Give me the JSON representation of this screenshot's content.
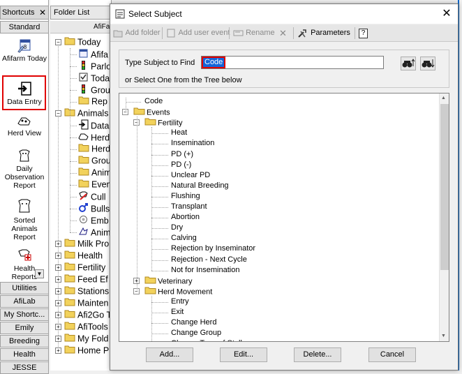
{
  "shortcuts": {
    "header": "Shortcuts",
    "close": "✕",
    "group_top": "Standard",
    "items": [
      {
        "label": "Afifarm Today",
        "icon": "calendar-icon"
      },
      {
        "label": "Data Entry",
        "icon": "data-entry-icon"
      },
      {
        "label": "Herd View",
        "icon": "herd-view-icon"
      },
      {
        "label": "Daily Observation Report",
        "icon": "cow-report-icon"
      },
      {
        "label": "Sorted Animals Report",
        "icon": "cow-sorted-icon"
      },
      {
        "label": "Health Reports",
        "icon": "health-icon"
      }
    ],
    "groups": [
      "Utilities",
      "AfiLab",
      "My Shortc...",
      "Emily",
      "Breeding",
      "Health",
      "JESSE"
    ]
  },
  "folder_list": {
    "header": "Folder List",
    "sub_header": "AfiFa",
    "rows": [
      {
        "label": "Today",
        "icon": "folder-icon",
        "level": 0,
        "expander": "−"
      },
      {
        "label": "Afifa",
        "icon": "calendar-icon",
        "level": 1
      },
      {
        "label": "Parlo",
        "icon": "traffic-light-icon",
        "level": 1
      },
      {
        "label": "Toda",
        "icon": "checkbox-icon",
        "level": 1
      },
      {
        "label": "Grou",
        "icon": "traffic-light-icon",
        "level": 1
      },
      {
        "label": "Rep",
        "icon": "folder-icon",
        "level": 1
      },
      {
        "label": "Animals",
        "icon": "folder-icon",
        "level": 0,
        "expander": "−"
      },
      {
        "label": "Data",
        "icon": "data-entry-icon",
        "level": 1
      },
      {
        "label": "Herd",
        "icon": "herd-view-icon",
        "level": 1
      },
      {
        "label": "Herd",
        "icon": "folder-icon",
        "level": 1
      },
      {
        "label": "Grou",
        "icon": "folder-icon",
        "level": 1
      },
      {
        "label": "Anim",
        "icon": "folder-icon",
        "level": 1
      },
      {
        "label": "Even",
        "icon": "folder-icon",
        "level": 1
      },
      {
        "label": "Cull",
        "icon": "cull-icon",
        "level": 1
      },
      {
        "label": "Bulls",
        "icon": "male-icon",
        "level": 1
      },
      {
        "label": "Emb",
        "icon": "embryo-icon",
        "level": 1
      },
      {
        "label": "Anim",
        "icon": "animal-icon",
        "level": 1
      },
      {
        "label": "Milk Pro",
        "icon": "folder-icon",
        "level": 0,
        "expander": "+"
      },
      {
        "label": "Health",
        "icon": "folder-icon",
        "level": 0,
        "expander": "+"
      },
      {
        "label": "Fertility",
        "icon": "folder-icon",
        "level": 0,
        "expander": "+"
      },
      {
        "label": "Feed Ef",
        "icon": "folder-icon",
        "level": 0,
        "expander": "+"
      },
      {
        "label": "Stations",
        "icon": "folder-icon",
        "level": 0,
        "expander": "+"
      },
      {
        "label": "Mainten",
        "icon": "folder-icon",
        "level": 0,
        "expander": "+"
      },
      {
        "label": "Afi2Go T",
        "icon": "folder-icon",
        "level": 0,
        "expander": "+"
      },
      {
        "label": "AfiTools",
        "icon": "folder-icon",
        "level": 0,
        "expander": "+"
      },
      {
        "label": "My Fold",
        "icon": "folder-icon",
        "level": 0,
        "expander": "+"
      },
      {
        "label": "Home P",
        "icon": "folder-icon",
        "level": 0,
        "expander": "+"
      }
    ]
  },
  "dialog": {
    "title": "Select Subject",
    "close": "✕",
    "toolbar": {
      "add_folder": "Add folder",
      "add_user_event": "Add user event",
      "rename": "Rename",
      "delete": "✕",
      "parameters": "Parameters",
      "help": "?"
    },
    "find_label": "Type Subject to Find",
    "find_value": "Code",
    "or_label": "or Select One from the Tree below",
    "tree": {
      "root_code": "Code",
      "events": "Events",
      "fertility": "Fertility",
      "fertility_items": [
        "Heat",
        "Insemination",
        "PD (+)",
        "PD (-)",
        "Unclear PD",
        "Natural Breeding",
        "Flushing",
        "Transplant",
        "Abortion",
        "Dry",
        "Calving",
        "Rejection by Inseminator",
        "Rejection - Next Cycle",
        "Not for Insemination"
      ],
      "veterinary": "Veterinary",
      "herd_movement": "Herd Movement",
      "herd_items": [
        "Entry",
        "Exit",
        "Change Herd",
        "Change Group",
        "Change Type of Stall"
      ]
    },
    "buttons": {
      "add": "Add...",
      "edit": "Edit...",
      "delete": "Delete...",
      "cancel": "Cancel"
    }
  },
  "colors": {
    "selection_blue": "#1565d8",
    "highlight_red": "#e00000",
    "folder_yellow": "#f2d25c"
  }
}
